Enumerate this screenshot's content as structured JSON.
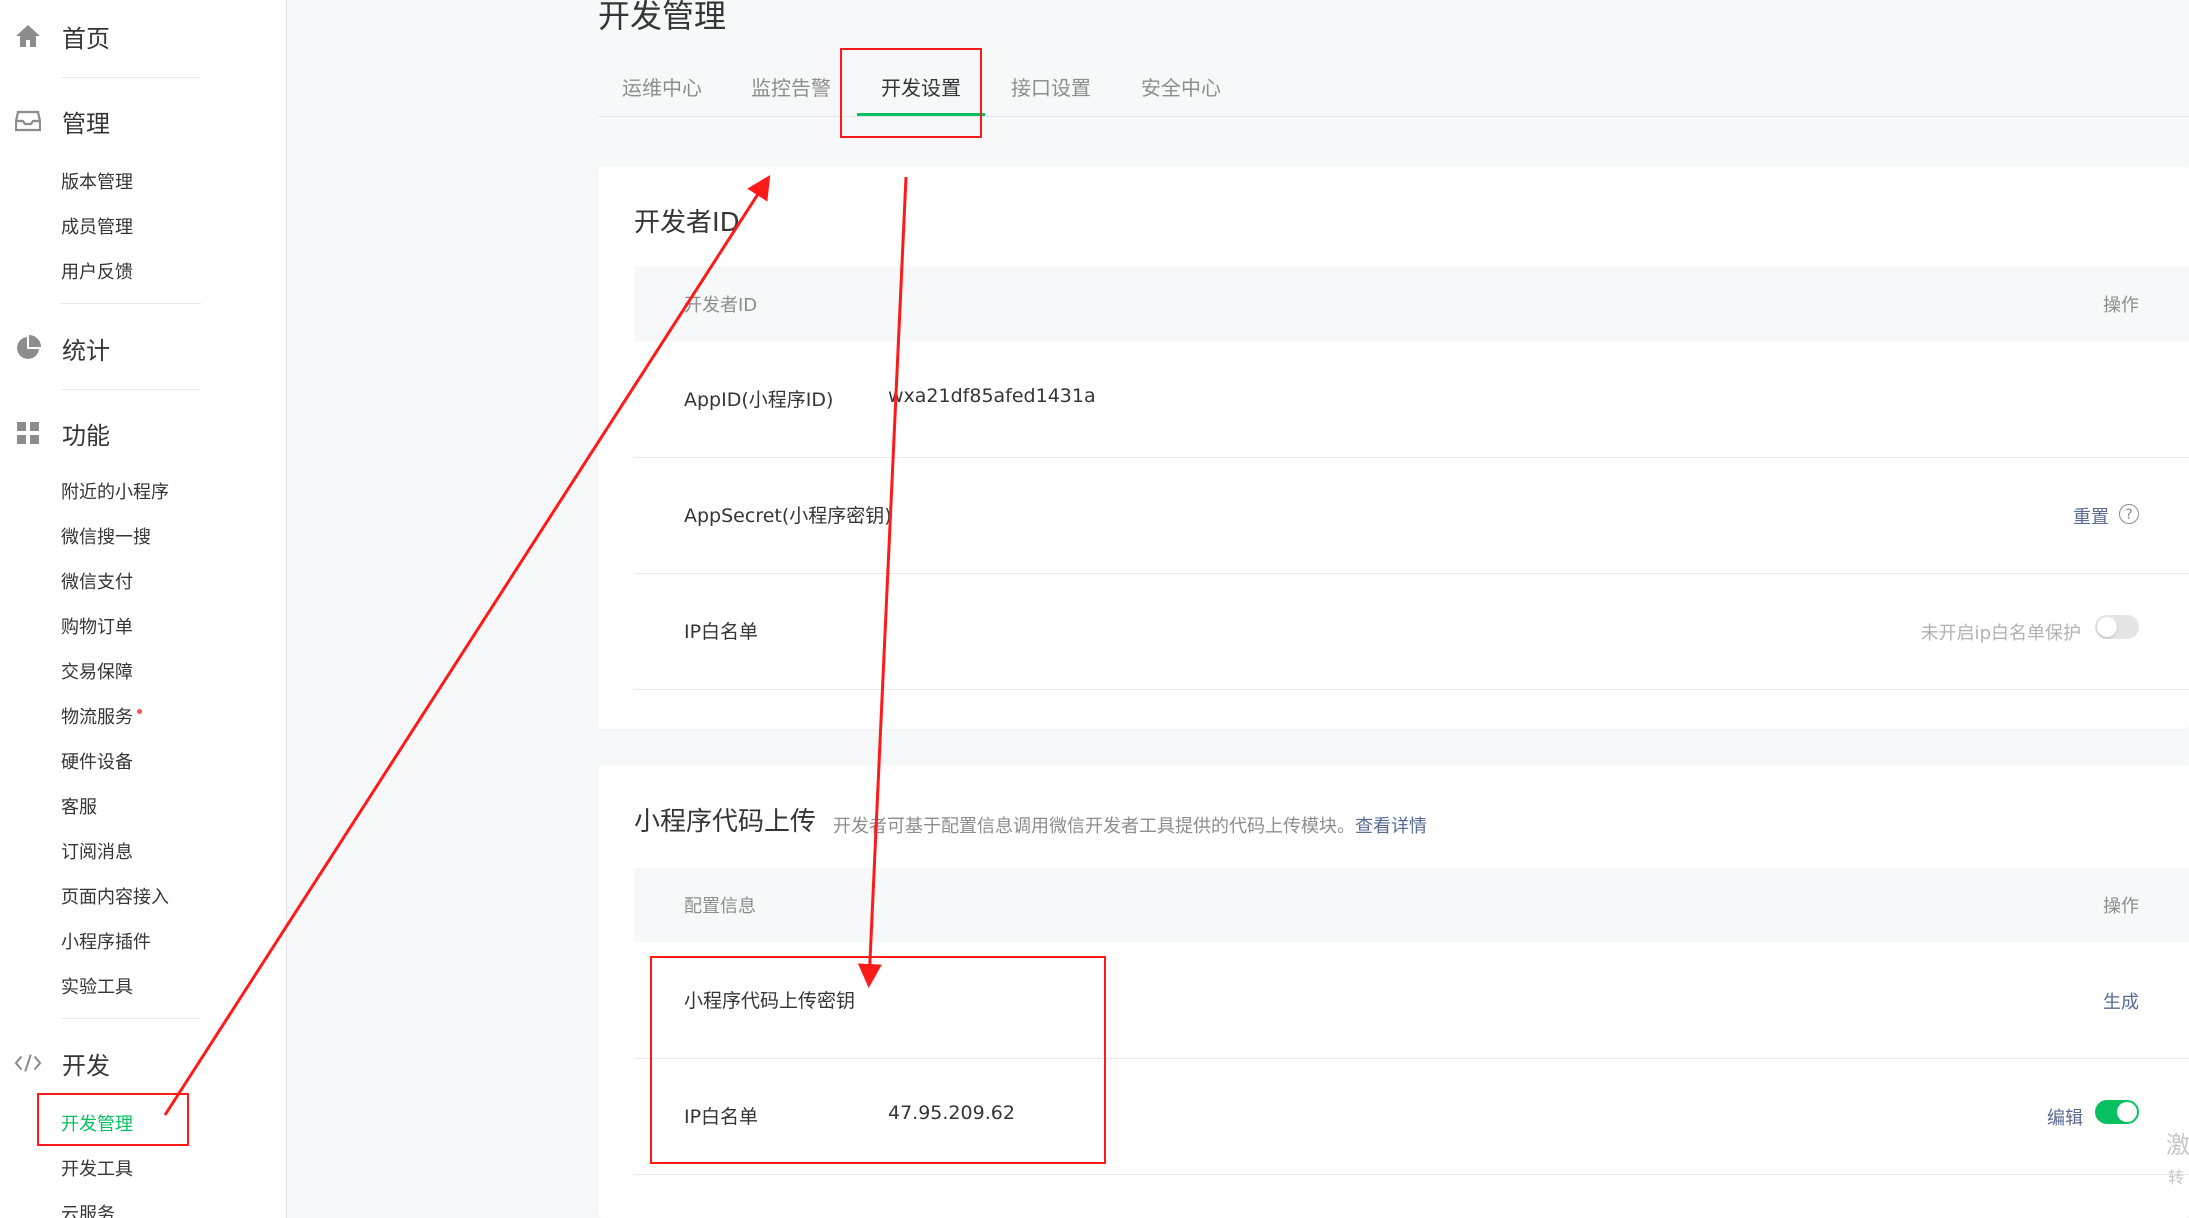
{
  "sidebar": {
    "home": {
      "label": "首页",
      "icon": "home-icon"
    },
    "manage": {
      "label": "管理",
      "icon": "inbox-icon",
      "items": [
        "版本管理",
        "成员管理",
        "用户反馈"
      ]
    },
    "stats": {
      "label": "统计",
      "icon": "pie-chart-icon"
    },
    "features": {
      "label": "功能",
      "icon": "grid-icon",
      "items": [
        "附近的小程序",
        "微信搜一搜",
        "微信支付",
        "购物订单",
        "交易保障",
        "物流服务",
        "硬件设备",
        "客服",
        "订阅消息",
        "页面内容接入",
        "小程序插件",
        "实验工具"
      ]
    },
    "dev": {
      "label": "开发",
      "icon": "code-icon",
      "items": [
        "开发管理",
        "开发工具",
        "云服务"
      ]
    }
  },
  "page": {
    "title": "开发管理",
    "tabs": [
      "运维中心",
      "监控告警",
      "开发设置",
      "接口设置",
      "安全中心"
    ],
    "active_tab": "开发设置"
  },
  "developer_id": {
    "title": "开发者ID",
    "header": {
      "left": "开发者ID",
      "right": "操作"
    },
    "appid": {
      "label": "AppID(小程序ID)",
      "value": "wxa21df85afed1431a"
    },
    "appsecret": {
      "label": "AppSecret(小程序密钥)",
      "action": "重置",
      "help": "?"
    },
    "ip_whitelist": {
      "label": "IP白名单",
      "status": "未开启ip白名单保护",
      "enabled": false
    }
  },
  "code_upload": {
    "title": "小程序代码上传",
    "desc": "开发者可基于配置信息调用微信开发者工具提供的代码上传模块。",
    "desc_link": "查看详情",
    "header": {
      "left": "配置信息",
      "right": "操作"
    },
    "key": {
      "label": "小程序代码上传密钥",
      "action": "生成"
    },
    "ip_whitelist": {
      "label": "IP白名单",
      "value": "47.95.209.62",
      "action": "编辑",
      "enabled": true
    }
  },
  "watermark": {
    "line1": "激",
    "line2": "转"
  },
  "colors": {
    "accent": "#07c160",
    "link": "#576b95",
    "annotation": "#ff1a1a"
  }
}
